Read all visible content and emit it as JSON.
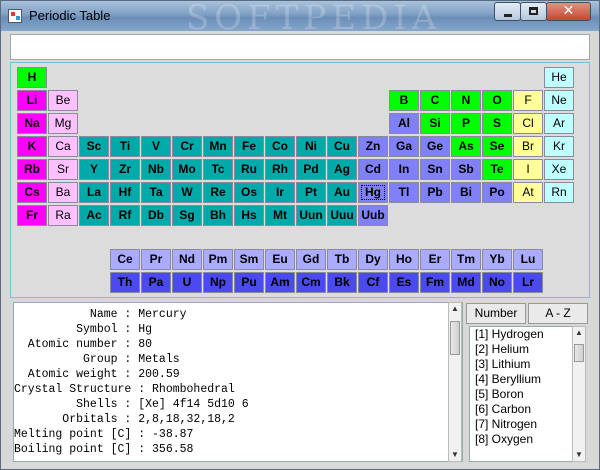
{
  "window": {
    "title": "Periodic Table",
    "watermark": "SOFTPEDIA"
  },
  "search": {
    "value": ""
  },
  "colors": {
    "alkali": "#ff00ff",
    "alkaline": "#ffc0ff",
    "transition": "#00aaaa",
    "metal": "#8080f8",
    "nonmetal": "#00ff00",
    "halogen": "#ffff99",
    "noble": "#c0ffff",
    "lanthanide": "#aaaaff",
    "actinide": "#4a4aee"
  },
  "elements": [
    {
      "s": "H",
      "r": 0,
      "c": 0,
      "g": "nonmetal"
    },
    {
      "s": "He",
      "r": 0,
      "c": 17,
      "g": "noble"
    },
    {
      "s": "Li",
      "r": 1,
      "c": 0,
      "g": "alkali"
    },
    {
      "s": "Be",
      "r": 1,
      "c": 1,
      "g": "alkaline"
    },
    {
      "s": "B",
      "r": 1,
      "c": 12,
      "g": "nonmetal"
    },
    {
      "s": "C",
      "r": 1,
      "c": 13,
      "g": "nonmetal"
    },
    {
      "s": "N",
      "r": 1,
      "c": 14,
      "g": "nonmetal"
    },
    {
      "s": "O",
      "r": 1,
      "c": 15,
      "g": "nonmetal"
    },
    {
      "s": "F",
      "r": 1,
      "c": 16,
      "g": "halogen"
    },
    {
      "s": "Ne",
      "r": 1,
      "c": 17,
      "g": "noble"
    },
    {
      "s": "Na",
      "r": 2,
      "c": 0,
      "g": "alkali"
    },
    {
      "s": "Mg",
      "r": 2,
      "c": 1,
      "g": "alkaline"
    },
    {
      "s": "Al",
      "r": 2,
      "c": 12,
      "g": "metal"
    },
    {
      "s": "Si",
      "r": 2,
      "c": 13,
      "g": "nonmetal"
    },
    {
      "s": "P",
      "r": 2,
      "c": 14,
      "g": "nonmetal"
    },
    {
      "s": "S",
      "r": 2,
      "c": 15,
      "g": "nonmetal"
    },
    {
      "s": "Cl",
      "r": 2,
      "c": 16,
      "g": "halogen"
    },
    {
      "s": "Ar",
      "r": 2,
      "c": 17,
      "g": "noble"
    },
    {
      "s": "K",
      "r": 3,
      "c": 0,
      "g": "alkali"
    },
    {
      "s": "Ca",
      "r": 3,
      "c": 1,
      "g": "alkaline"
    },
    {
      "s": "Sc",
      "r": 3,
      "c": 2,
      "g": "transition"
    },
    {
      "s": "Ti",
      "r": 3,
      "c": 3,
      "g": "transition"
    },
    {
      "s": "V",
      "r": 3,
      "c": 4,
      "g": "transition"
    },
    {
      "s": "Cr",
      "r": 3,
      "c": 5,
      "g": "transition"
    },
    {
      "s": "Mn",
      "r": 3,
      "c": 6,
      "g": "transition"
    },
    {
      "s": "Fe",
      "r": 3,
      "c": 7,
      "g": "transition"
    },
    {
      "s": "Co",
      "r": 3,
      "c": 8,
      "g": "transition"
    },
    {
      "s": "Ni",
      "r": 3,
      "c": 9,
      "g": "transition"
    },
    {
      "s": "Cu",
      "r": 3,
      "c": 10,
      "g": "transition"
    },
    {
      "s": "Zn",
      "r": 3,
      "c": 11,
      "g": "metal"
    },
    {
      "s": "Ga",
      "r": 3,
      "c": 12,
      "g": "metal"
    },
    {
      "s": "Ge",
      "r": 3,
      "c": 13,
      "g": "metal"
    },
    {
      "s": "As",
      "r": 3,
      "c": 14,
      "g": "nonmetal"
    },
    {
      "s": "Se",
      "r": 3,
      "c": 15,
      "g": "nonmetal"
    },
    {
      "s": "Br",
      "r": 3,
      "c": 16,
      "g": "halogen"
    },
    {
      "s": "Kr",
      "r": 3,
      "c": 17,
      "g": "noble"
    },
    {
      "s": "Rb",
      "r": 4,
      "c": 0,
      "g": "alkali"
    },
    {
      "s": "Sr",
      "r": 4,
      "c": 1,
      "g": "alkaline"
    },
    {
      "s": "Y",
      "r": 4,
      "c": 2,
      "g": "transition"
    },
    {
      "s": "Zr",
      "r": 4,
      "c": 3,
      "g": "transition"
    },
    {
      "s": "Nb",
      "r": 4,
      "c": 4,
      "g": "transition"
    },
    {
      "s": "Mo",
      "r": 4,
      "c": 5,
      "g": "transition"
    },
    {
      "s": "Tc",
      "r": 4,
      "c": 6,
      "g": "transition"
    },
    {
      "s": "Ru",
      "r": 4,
      "c": 7,
      "g": "transition"
    },
    {
      "s": "Rh",
      "r": 4,
      "c": 8,
      "g": "transition"
    },
    {
      "s": "Pd",
      "r": 4,
      "c": 9,
      "g": "transition"
    },
    {
      "s": "Ag",
      "r": 4,
      "c": 10,
      "g": "transition"
    },
    {
      "s": "Cd",
      "r": 4,
      "c": 11,
      "g": "metal"
    },
    {
      "s": "In",
      "r": 4,
      "c": 12,
      "g": "metal"
    },
    {
      "s": "Sn",
      "r": 4,
      "c": 13,
      "g": "metal"
    },
    {
      "s": "Sb",
      "r": 4,
      "c": 14,
      "g": "metal"
    },
    {
      "s": "Te",
      "r": 4,
      "c": 15,
      "g": "nonmetal"
    },
    {
      "s": "I",
      "r": 4,
      "c": 16,
      "g": "halogen"
    },
    {
      "s": "Xe",
      "r": 4,
      "c": 17,
      "g": "noble"
    },
    {
      "s": "Cs",
      "r": 5,
      "c": 0,
      "g": "alkali"
    },
    {
      "s": "Ba",
      "r": 5,
      "c": 1,
      "g": "alkaline"
    },
    {
      "s": "La",
      "r": 5,
      "c": 2,
      "g": "transition"
    },
    {
      "s": "Hf",
      "r": 5,
      "c": 3,
      "g": "transition"
    },
    {
      "s": "Ta",
      "r": 5,
      "c": 4,
      "g": "transition"
    },
    {
      "s": "W",
      "r": 5,
      "c": 5,
      "g": "transition"
    },
    {
      "s": "Re",
      "r": 5,
      "c": 6,
      "g": "transition"
    },
    {
      "s": "Os",
      "r": 5,
      "c": 7,
      "g": "transition"
    },
    {
      "s": "Ir",
      "r": 5,
      "c": 8,
      "g": "transition"
    },
    {
      "s": "Pt",
      "r": 5,
      "c": 9,
      "g": "transition"
    },
    {
      "s": "Au",
      "r": 5,
      "c": 10,
      "g": "transition"
    },
    {
      "s": "Hg",
      "r": 5,
      "c": 11,
      "g": "metal",
      "sel": true
    },
    {
      "s": "Tl",
      "r": 5,
      "c": 12,
      "g": "metal"
    },
    {
      "s": "Pb",
      "r": 5,
      "c": 13,
      "g": "metal"
    },
    {
      "s": "Bi",
      "r": 5,
      "c": 14,
      "g": "metal"
    },
    {
      "s": "Po",
      "r": 5,
      "c": 15,
      "g": "metal"
    },
    {
      "s": "At",
      "r": 5,
      "c": 16,
      "g": "halogen"
    },
    {
      "s": "Rn",
      "r": 5,
      "c": 17,
      "g": "noble"
    },
    {
      "s": "Fr",
      "r": 6,
      "c": 0,
      "g": "alkali"
    },
    {
      "s": "Ra",
      "r": 6,
      "c": 1,
      "g": "alkaline"
    },
    {
      "s": "Ac",
      "r": 6,
      "c": 2,
      "g": "transition"
    },
    {
      "s": "Rf",
      "r": 6,
      "c": 3,
      "g": "transition"
    },
    {
      "s": "Db",
      "r": 6,
      "c": 4,
      "g": "transition"
    },
    {
      "s": "Sg",
      "r": 6,
      "c": 5,
      "g": "transition"
    },
    {
      "s": "Bh",
      "r": 6,
      "c": 6,
      "g": "transition"
    },
    {
      "s": "Hs",
      "r": 6,
      "c": 7,
      "g": "transition"
    },
    {
      "s": "Mt",
      "r": 6,
      "c": 8,
      "g": "transition"
    },
    {
      "s": "Uun",
      "r": 6,
      "c": 9,
      "g": "transition"
    },
    {
      "s": "Uuu",
      "r": 6,
      "c": 10,
      "g": "transition"
    },
    {
      "s": "Uub",
      "r": 6,
      "c": 11,
      "g": "metal"
    },
    {
      "s": "Ce",
      "r": 7,
      "c": 3,
      "g": "lanthanide"
    },
    {
      "s": "Pr",
      "r": 7,
      "c": 4,
      "g": "lanthanide"
    },
    {
      "s": "Nd",
      "r": 7,
      "c": 5,
      "g": "lanthanide"
    },
    {
      "s": "Pm",
      "r": 7,
      "c": 6,
      "g": "lanthanide"
    },
    {
      "s": "Sm",
      "r": 7,
      "c": 7,
      "g": "lanthanide"
    },
    {
      "s": "Eu",
      "r": 7,
      "c": 8,
      "g": "lanthanide"
    },
    {
      "s": "Gd",
      "r": 7,
      "c": 9,
      "g": "lanthanide"
    },
    {
      "s": "Tb",
      "r": 7,
      "c": 10,
      "g": "lanthanide"
    },
    {
      "s": "Dy",
      "r": 7,
      "c": 11,
      "g": "lanthanide"
    },
    {
      "s": "Ho",
      "r": 7,
      "c": 12,
      "g": "lanthanide"
    },
    {
      "s": "Er",
      "r": 7,
      "c": 13,
      "g": "lanthanide"
    },
    {
      "s": "Tm",
      "r": 7,
      "c": 14,
      "g": "lanthanide"
    },
    {
      "s": "Yb",
      "r": 7,
      "c": 15,
      "g": "lanthanide"
    },
    {
      "s": "Lu",
      "r": 7,
      "c": 16,
      "g": "lanthanide"
    },
    {
      "s": "Th",
      "r": 8,
      "c": 3,
      "g": "actinide"
    },
    {
      "s": "Pa",
      "r": 8,
      "c": 4,
      "g": "actinide"
    },
    {
      "s": "U",
      "r": 8,
      "c": 5,
      "g": "actinide"
    },
    {
      "s": "Np",
      "r": 8,
      "c": 6,
      "g": "actinide"
    },
    {
      "s": "Pu",
      "r": 8,
      "c": 7,
      "g": "actinide"
    },
    {
      "s": "Am",
      "r": 8,
      "c": 8,
      "g": "actinide"
    },
    {
      "s": "Cm",
      "r": 8,
      "c": 9,
      "g": "actinide"
    },
    {
      "s": "Bk",
      "r": 8,
      "c": 10,
      "g": "actinide"
    },
    {
      "s": "Cf",
      "r": 8,
      "c": 11,
      "g": "actinide"
    },
    {
      "s": "Es",
      "r": 8,
      "c": 12,
      "g": "actinide"
    },
    {
      "s": "Fm",
      "r": 8,
      "c": 13,
      "g": "actinide"
    },
    {
      "s": "Md",
      "r": 8,
      "c": 14,
      "g": "actinide"
    },
    {
      "s": "No",
      "r": 8,
      "c": 15,
      "g": "actinide"
    },
    {
      "s": "Lr",
      "r": 8,
      "c": 16,
      "g": "actinide"
    }
  ],
  "info": {
    "lines": [
      "           Name : Mercury",
      "         Symbol : Hg",
      "  Atomic number : 80",
      "          Group : Metals",
      "  Atomic weight : 200.59",
      "Crystal Structure : Rhombohedral",
      "         Shells : [Xe] 4f14 5d10 6",
      "       Orbitals : 2,8,18,32,18,2",
      "Melting point [C] : -38.87",
      "Boiling point [C] : 356.58"
    ]
  },
  "tabs": {
    "number": "Number",
    "az": "A - Z"
  },
  "list": {
    "items": [
      "[1] Hydrogen",
      "[2] Helium",
      "[3] Lithium",
      "[4] Beryllium",
      "[5] Boron",
      "[6] Carbon",
      "[7] Nitrogen",
      "[8] Oxygen"
    ]
  }
}
